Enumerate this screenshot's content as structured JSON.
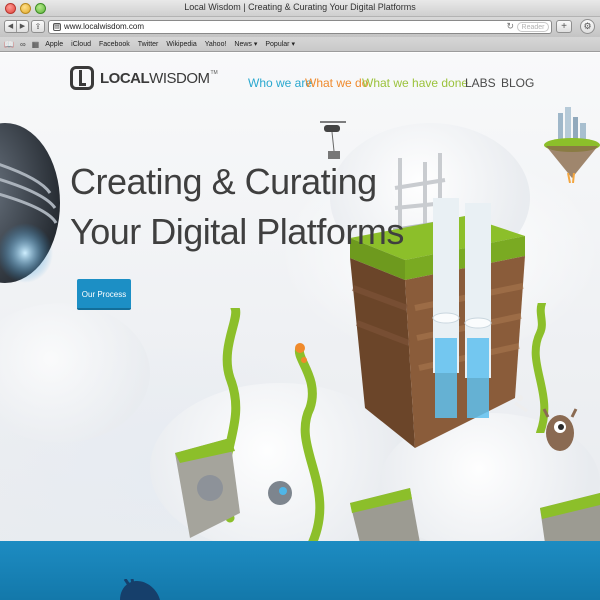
{
  "window": {
    "title": "Local Wisdom | Creating & Curating Your Digital Platforms"
  },
  "toolbar": {
    "url": "www.localwisdom.com",
    "reader_label": "Reader"
  },
  "bookmarks": [
    "Apple",
    "iCloud",
    "Facebook",
    "Twitter",
    "Wikipedia",
    "Yahoo!",
    "News ▾",
    "Popular ▾"
  ],
  "site": {
    "logo_bold": "LOCAL",
    "logo_light": "WISDOM",
    "logo_tm": "TM",
    "nav": {
      "who": "Who we are",
      "what": "What we do",
      "done": "What we have done",
      "labs": "LABS",
      "blog": "BLOG"
    },
    "hero": {
      "line1": "Creating & Curating",
      "line2": "Your Digital Platforms"
    },
    "cta_label": "Our Process"
  },
  "colors": {
    "accent_blue": "#1c8fc5",
    "nav_who": "#2aa8cf",
    "nav_what": "#ef8a2d",
    "nav_done": "#9bc23b",
    "grass": "#8cbf2a",
    "soil": "#7a5236"
  },
  "icons": {
    "favicon": "page-icon",
    "reload": "reload-icon",
    "share": "share-icon",
    "plus": "plus-icon",
    "gear": "gear-icon",
    "reading-list": "glasses-icon",
    "bookmarks-book": "book-icon",
    "top-sites": "grid-icon"
  }
}
